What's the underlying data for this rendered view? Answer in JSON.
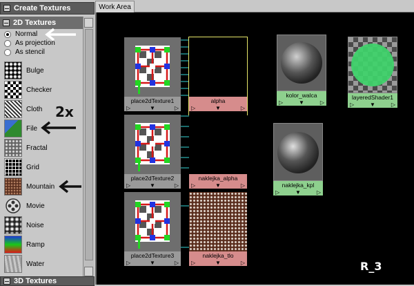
{
  "panel": {
    "header": "Create Textures",
    "section": "2D Textures",
    "bottom_section": "3D Textures",
    "modes": [
      {
        "label": "Normal",
        "selected": true
      },
      {
        "label": "As projection",
        "selected": false
      },
      {
        "label": "As stencil",
        "selected": false
      }
    ],
    "textures": [
      {
        "label": "Bulge",
        "icon": "bulge-icon"
      },
      {
        "label": "Checker",
        "icon": "checker-icon"
      },
      {
        "label": "Cloth",
        "icon": "cloth-icon"
      },
      {
        "label": "File",
        "icon": "file-icon"
      },
      {
        "label": "Fractal",
        "icon": "fractal-icon"
      },
      {
        "label": "Grid",
        "icon": "grid-icon"
      },
      {
        "label": "Mountain",
        "icon": "mountain-icon"
      },
      {
        "label": "Movie",
        "icon": "movie-icon"
      },
      {
        "label": "Noise",
        "icon": "noise-icon"
      },
      {
        "label": "Ramp",
        "icon": "ramp-icon"
      },
      {
        "label": "Water",
        "icon": "water-icon"
      }
    ]
  },
  "annotations": {
    "multiplier": "2x",
    "watermark": "R_3"
  },
  "workarea": {
    "tab": "Work Area",
    "place_nodes": [
      "place2dTexture1",
      "place2dTexture2",
      "place2dTexture3"
    ],
    "texture_nodes": [
      "alpha",
      "naklejka_alpha",
      "naklejka_tlo"
    ],
    "shader_nodes": [
      "kolor_walca",
      "layeredShader1",
      "naklejka_kpl"
    ]
  },
  "colors": {
    "place_bar": "#9a9a9a",
    "texture_bar": "#d68c8c",
    "shader_bar": "#8ed08e",
    "connection": "#33d6d6",
    "selection": "#e8e86a"
  }
}
